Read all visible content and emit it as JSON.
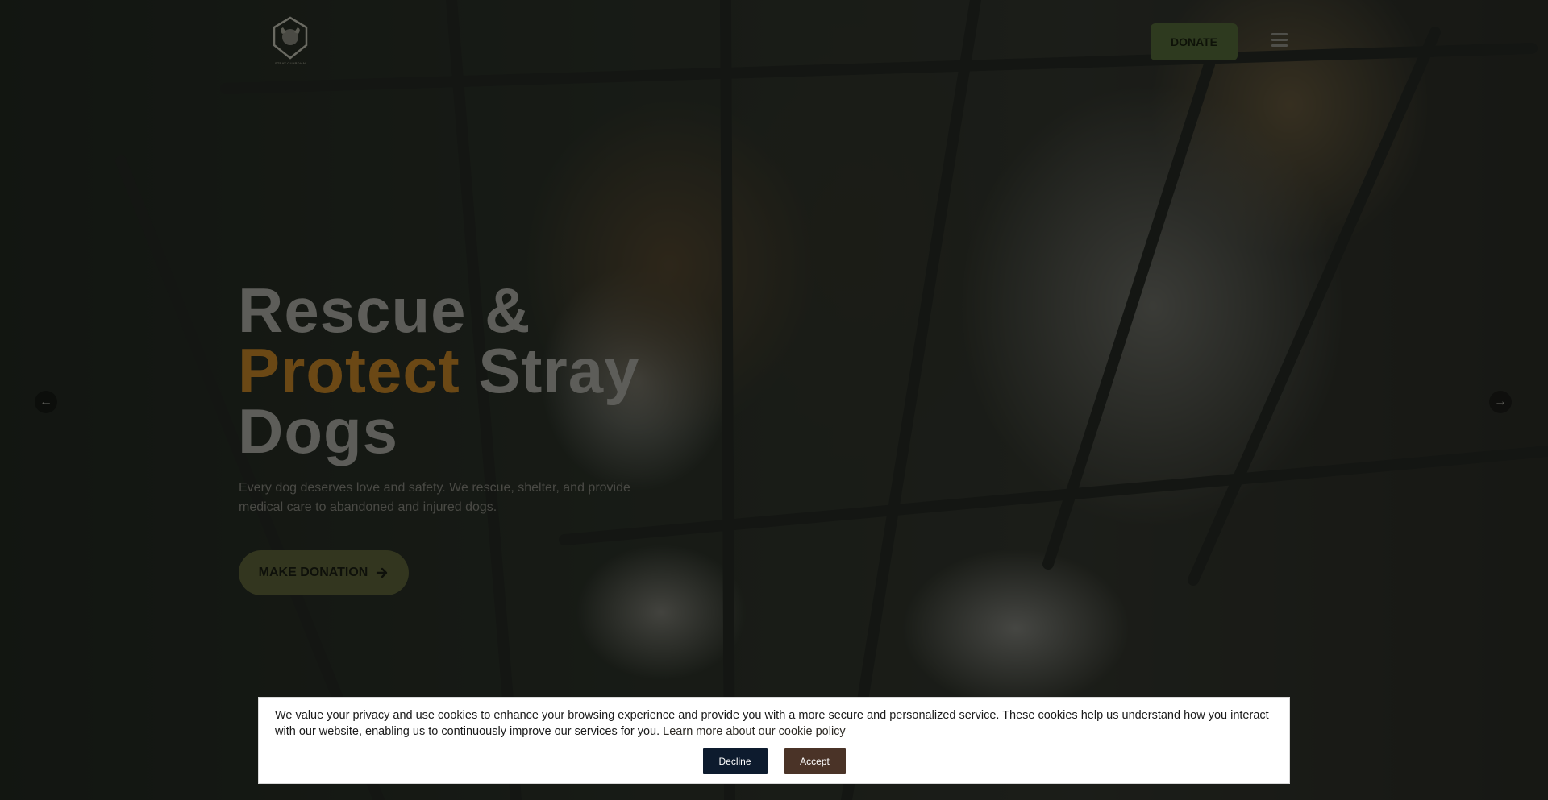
{
  "header": {
    "logo_text": "STRAY GUARDIAN",
    "donate_label": "DONATE",
    "menu_icon": "hamburger-menu-icon"
  },
  "hero": {
    "headline_line1": "Rescue &",
    "headline_accent": "Protect",
    "headline_rest": "Stray",
    "headline_line3": "Dogs",
    "description": "Every dog deserves love and safety. We rescue, shelter, and provide medical care to abandoned and injured dogs.",
    "cta_label": "MAKE DONATION",
    "cta_icon": "arrow-right-icon",
    "prev_icon": "arrow-left-icon",
    "next_icon": "arrow-right-icon"
  },
  "cookie_banner": {
    "message": "We value your privacy and use cookies to enhance your browsing experience and provide you with a more secure and personalized service. These cookies help us understand how you interact with our website, enabling us to continuously improve our services for you.",
    "link_text": "Learn more about our cookie policy",
    "decline_label": "Decline",
    "accept_label": "Accept"
  },
  "colors": {
    "accent": "#6b4815",
    "decline_button": "#0d1b2e",
    "accept_button": "#4a3327"
  }
}
